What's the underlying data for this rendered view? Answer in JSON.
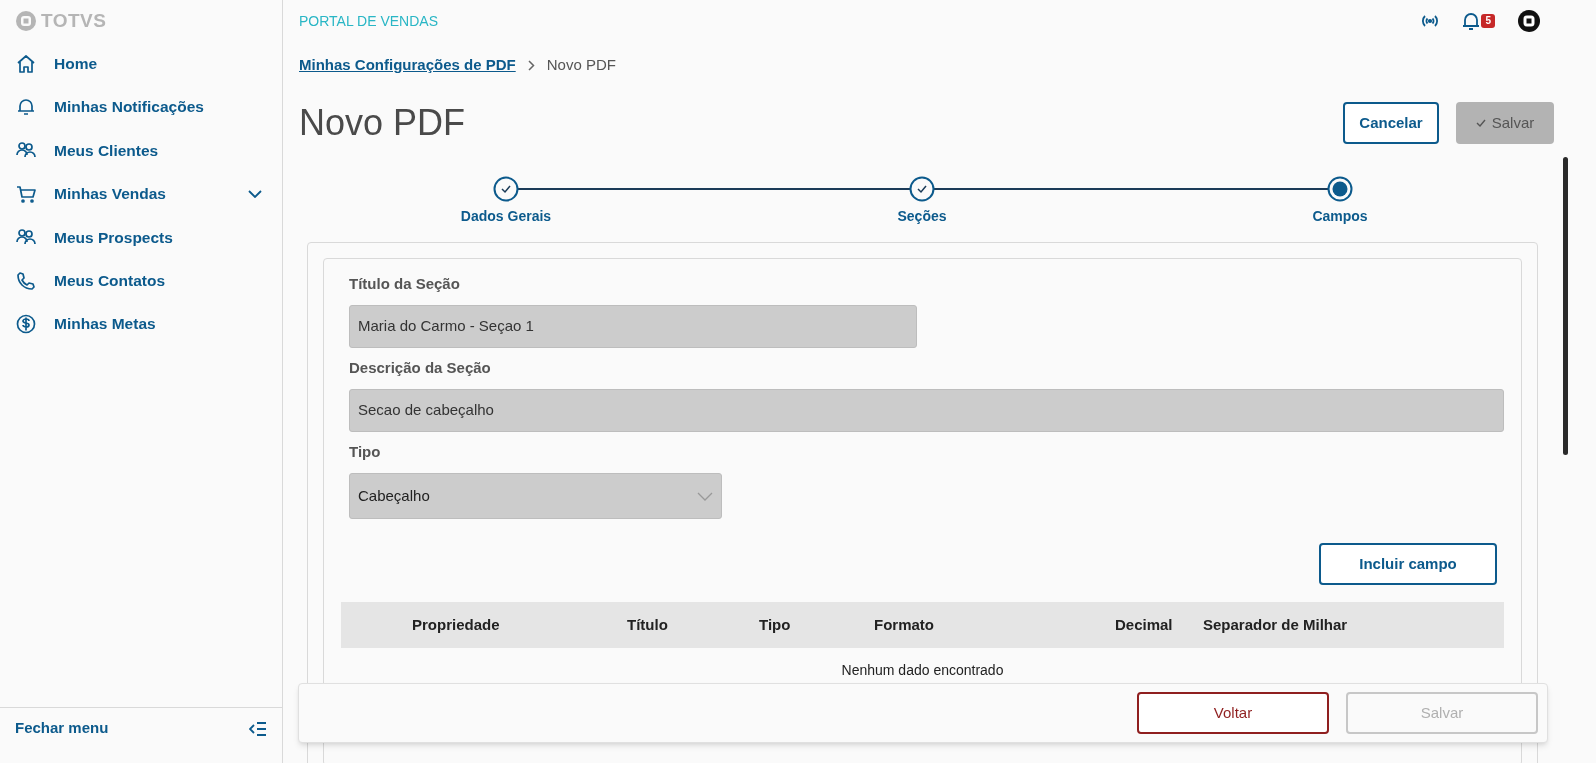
{
  "sidebar": {
    "logo": "TOTVS",
    "items": [
      {
        "label": "Home",
        "has_submenu": false
      },
      {
        "label": "Minhas Notificações",
        "has_submenu": false
      },
      {
        "label": "Meus Clientes",
        "has_submenu": false
      },
      {
        "label": "Minhas Vendas",
        "has_submenu": true
      },
      {
        "label": "Meus Prospects",
        "has_submenu": false
      },
      {
        "label": "Meus Contatos",
        "has_submenu": false
      },
      {
        "label": "Minhas Metas",
        "has_submenu": false
      }
    ],
    "footer": "Fechar menu"
  },
  "header": {
    "title": "PORTAL DE VENDAS",
    "notifications": "5"
  },
  "breadcrumb": [
    {
      "label": "Minhas Configurações de PDF",
      "link": true
    },
    {
      "label": "Novo PDF",
      "link": false
    }
  ],
  "page_title": "Novo PDF",
  "actions": [
    {
      "label": "Cancelar",
      "disabled": false
    },
    {
      "label": "Salvar",
      "disabled": true
    }
  ],
  "steps": [
    {
      "label": "Dados Gerais",
      "completed": true,
      "selected": false
    },
    {
      "label": "Seções",
      "completed": true,
      "selected": false
    },
    {
      "label": "Campos",
      "completed": false,
      "selected": true
    }
  ],
  "form": {
    "fields": [
      {
        "kind": "input",
        "label": "Título da Seção",
        "value": "Maria do Carmo - Seçao 1",
        "disabled": true
      },
      {
        "kind": "input",
        "label": "Descrição da Seção",
        "value": "Secao de cabeçalho",
        "disabled": true
      },
      {
        "kind": "select",
        "label": "Tipo",
        "value": "Cabeçalho",
        "disabled": true
      }
    ],
    "add_button": "Incluir campo"
  },
  "table": {
    "columns": [
      "Propriedade",
      "Título",
      "Tipo",
      "Formato",
      "Decimal",
      "Separador de Milhar"
    ],
    "empty_text": "Nenhum dado encontrado"
  },
  "footer": [
    {
      "label": "Voltar",
      "disabled": false
    },
    {
      "label": "Salvar",
      "disabled": true
    }
  ]
}
